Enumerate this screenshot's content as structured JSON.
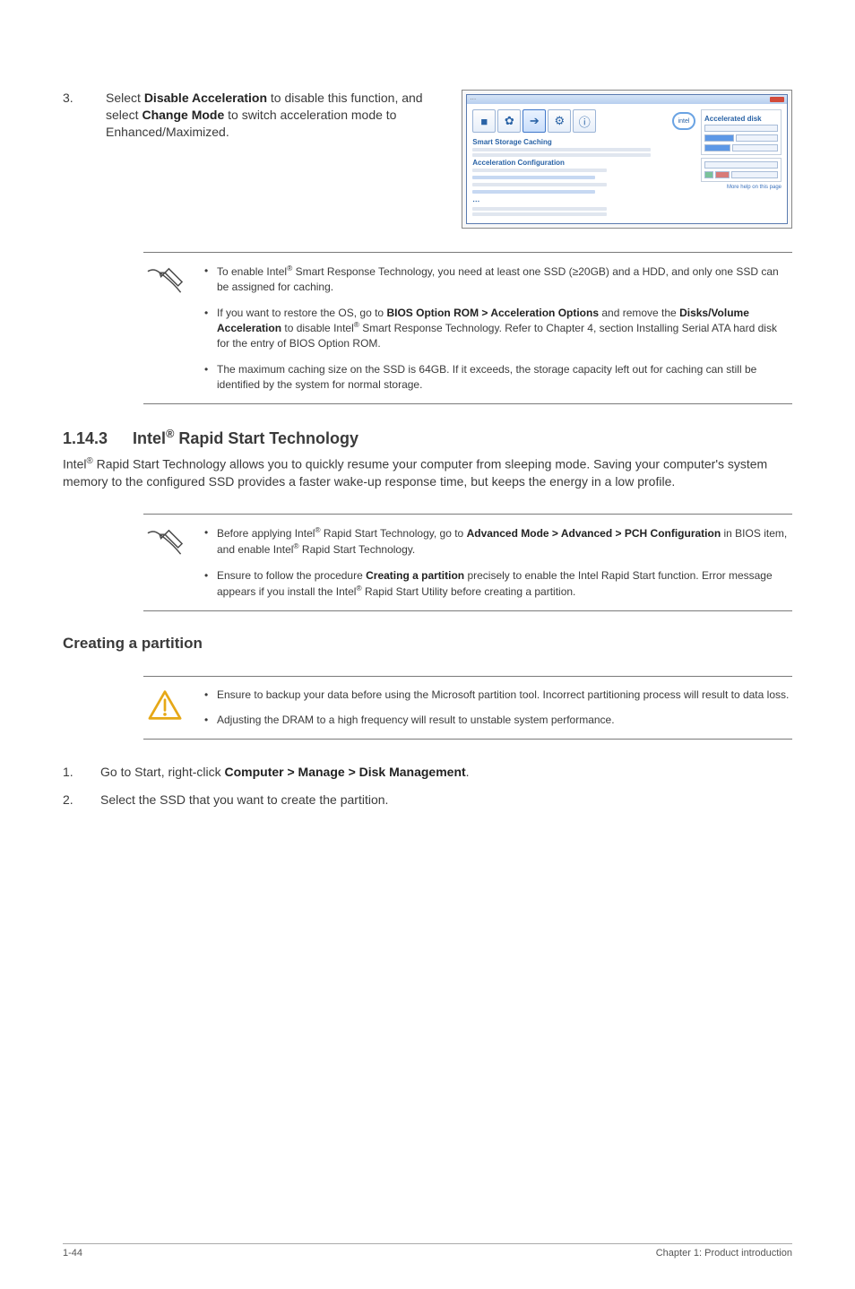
{
  "step3": {
    "num": "3.",
    "text_pre": "Select ",
    "bold1": "Disable Acceleration",
    "text_mid1": " to disable this function, and select ",
    "bold2": "Change Mode",
    "text_mid2": " to switch acceleration mode to Enhanced/Maximized."
  },
  "screenshot": {
    "heading": "Smart Storage Caching",
    "subhead": "Acceleration Configuration",
    "side_title": "Accelerated disk",
    "more": "More help on this page"
  },
  "note1": {
    "b1_pre": "To enable Intel",
    "b1_sup": "®",
    "b1_mid": " Smart Response Technology, you need at least one SSD (≥20GB) and a HDD, and only one SSD can be assigned for caching.",
    "b2_pre": "If you want to restore the OS, go to ",
    "b2_bold1": "BIOS Option ROM > Acceleration Options",
    "b2_mid1": " and remove the ",
    "b2_bold2": "Disks/Volume Acceleration",
    "b2_mid2": " to disable Intel",
    "b2_sup": "®",
    "b2_tail": " Smart Response Technology. Refer to Chapter 4, section Installing Serial ATA hard disk for the entry of BIOS Option ROM.",
    "b3": "The maximum caching size on the SSD is 64GB. If it exceeds, the storage capacity left out for caching can still be identified by the system for normal storage."
  },
  "section": {
    "num": "1.14.3",
    "title_pre": "Intel",
    "title_sup": "®",
    "title_post": " Rapid Start Technology",
    "para_pre": "Intel",
    "para_sup": "®",
    "para_body": " Rapid Start Technology allows you to quickly resume your computer from sleeping mode. Saving your computer's system memory to the configured SSD provides a faster wake-up response time, but keeps the energy in a low profile."
  },
  "note2": {
    "b1_pre": "Before applying Intel",
    "b1_sup": "®",
    "b1_mid": " Rapid Start Technology, go to ",
    "b1_bold": "Advanced Mode > Advanced > PCH Configuration",
    "b1_mid2": " in BIOS item, and enable Intel",
    "b1_sup2": "®",
    "b1_tail": " Rapid Start Technology.",
    "b2_pre": "Ensure to follow the procedure ",
    "b2_bold": "Creating a partition",
    "b2_mid": " precisely to enable the Intel Rapid Start function. Error message appears if you install the Intel",
    "b2_sup": "®",
    "b2_tail": " Rapid Start Utility before creating a partition."
  },
  "create": {
    "heading": "Creating a partition"
  },
  "caution": {
    "b1": "Ensure to backup your data before using the Microsoft partition tool. Incorrect partitioning process will result to data loss.",
    "b2": "Adjusting the DRAM to a high frequency will result to unstable system performance."
  },
  "steps2": {
    "n1": "1.",
    "t1_pre": "Go to Start, right-click ",
    "t1_bold": "Computer > Manage > Disk Management",
    "t1_post": ".",
    "n2": "2.",
    "t2": "Select the SSD that you want to create the partition."
  },
  "footer": {
    "left": "1-44",
    "right": "Chapter 1: Product introduction"
  }
}
